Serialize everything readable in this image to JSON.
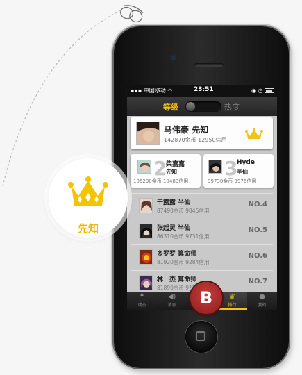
{
  "colors": {
    "accent": "#f2c318",
    "badge": "#f5c400",
    "fab": "#b52a2a"
  },
  "status_bar": {
    "carrier": "中国移动",
    "time": "23:51"
  },
  "nav": {
    "tab_active": "等级",
    "tab_inactive": "热度"
  },
  "rank_first": {
    "name": "马伟豪",
    "title": "先知",
    "coins": "142870金币",
    "credit": "12950信用"
  },
  "rank_second": {
    "number": "2",
    "name": "柴嘉嘉",
    "title": "先知",
    "coins": "105290金币",
    "credit": "10480信用"
  },
  "rank_third": {
    "number": "3",
    "name": "Hyde",
    "title": "半仙",
    "coins": "99730金币",
    "credit": "9976信用"
  },
  "rank_rows": [
    {
      "name": "干露露",
      "title": "半仙",
      "coins": "87490金币",
      "credit": "9845信用",
      "no": "NO.4"
    },
    {
      "name": "张起灵",
      "title": "半仙",
      "coins": "86310金币",
      "credit": "9731信用",
      "no": "NO.5"
    },
    {
      "name": "多罗罗",
      "title": "算命师",
      "coins": "81920金币",
      "credit": "9284信用",
      "no": "NO.6"
    },
    {
      "name": "林　杰",
      "title": "算命师",
      "coins": "81890金币",
      "credit": "9??信用",
      "no": "NO.7"
    }
  ],
  "tabbar": [
    {
      "label": "动态",
      "icon": "chat-icon"
    },
    {
      "label": "消息",
      "icon": "speaker-icon"
    },
    {
      "label": "",
      "icon": "blank"
    },
    {
      "label": "排行",
      "icon": "crown-icon"
    },
    {
      "label": "我的",
      "icon": "person-icon"
    }
  ],
  "fab": {
    "letter": "B"
  },
  "badge": {
    "label": "先知"
  }
}
